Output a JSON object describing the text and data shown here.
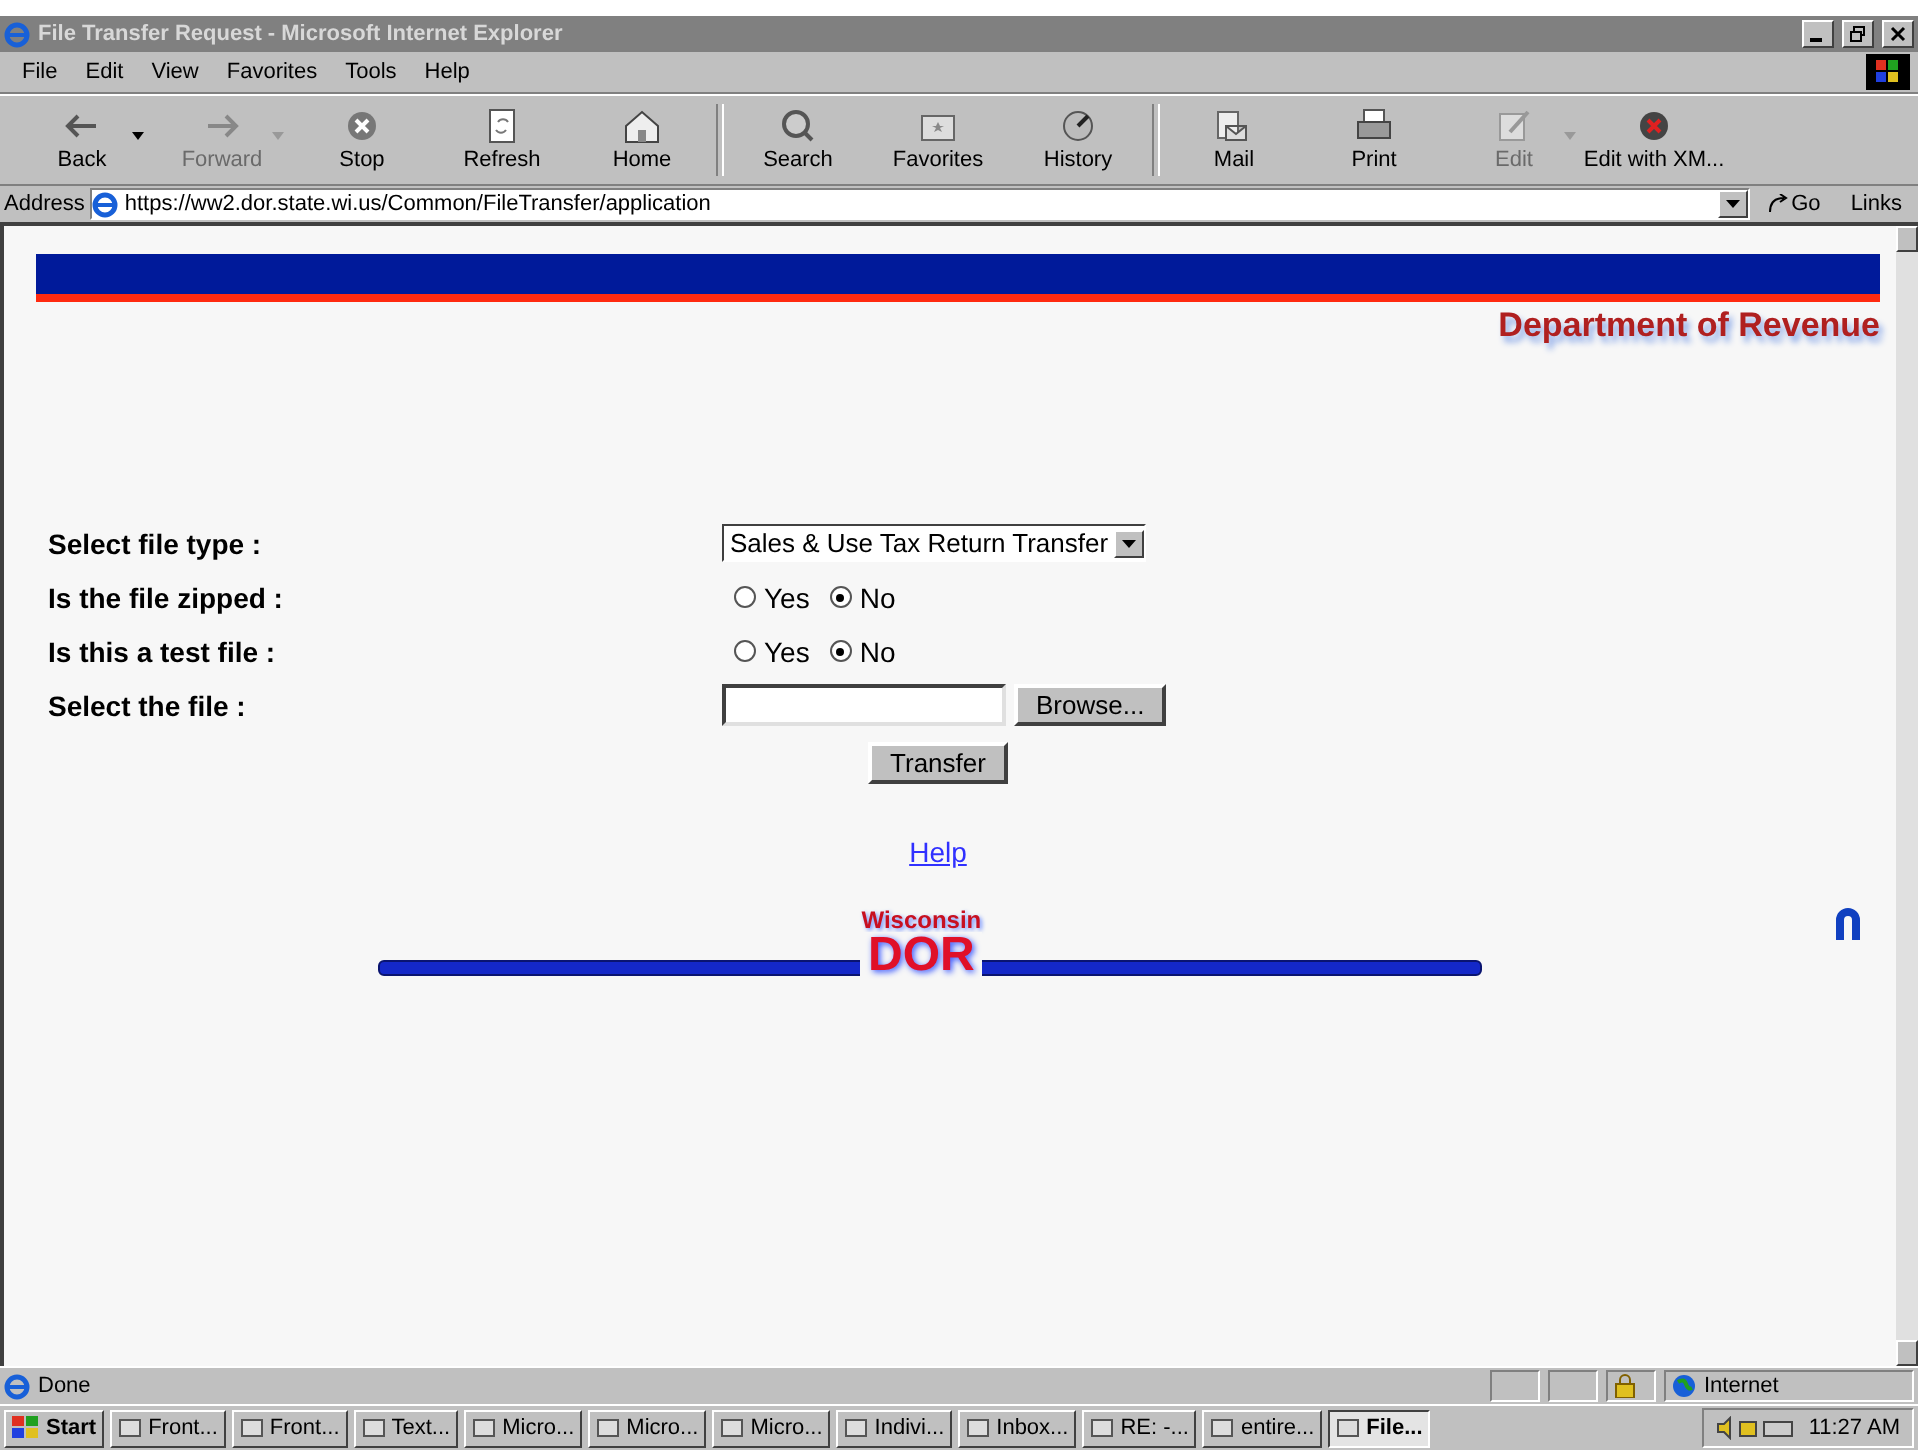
{
  "window": {
    "title": "File Transfer Request - Microsoft Internet Explorer"
  },
  "menu": [
    "File",
    "Edit",
    "View",
    "Favorites",
    "Tools",
    "Help"
  ],
  "toolbar": [
    {
      "kind": "back",
      "label": "Back",
      "disabled": false,
      "dropdown": true
    },
    {
      "kind": "forward",
      "label": "Forward",
      "disabled": true,
      "dropdown": true
    },
    {
      "kind": "stop",
      "label": "Stop",
      "disabled": false,
      "dropdown": false
    },
    {
      "kind": "refresh",
      "label": "Refresh",
      "disabled": false,
      "dropdown": false
    },
    {
      "kind": "home",
      "label": "Home",
      "disabled": false,
      "dropdown": false
    },
    {
      "kind": "search",
      "label": "Search",
      "disabled": false,
      "dropdown": false
    },
    {
      "kind": "favorites",
      "label": "Favorites",
      "disabled": false,
      "dropdown": false
    },
    {
      "kind": "history",
      "label": "History",
      "disabled": false,
      "dropdown": false
    },
    {
      "kind": "mail",
      "label": "Mail",
      "disabled": false,
      "dropdown": false
    },
    {
      "kind": "print",
      "label": "Print",
      "disabled": false,
      "dropdown": false
    },
    {
      "kind": "edit",
      "label": "Edit",
      "disabled": true,
      "dropdown": true
    },
    {
      "kind": "xm",
      "label": "Edit with XM...",
      "disabled": false,
      "dropdown": false
    }
  ],
  "address": {
    "label": "Address",
    "value": "https://ww2.dor.state.wi.us/Common/FileTransfer/application",
    "go": "Go",
    "links": "Links"
  },
  "page": {
    "header": "Department of Revenue",
    "rows": [
      {
        "kind": "select",
        "label": "Select file type :",
        "value": "Sales & Use Tax Return Transfer"
      },
      {
        "kind": "radio",
        "label": "Is the file zipped :",
        "options": [
          {
            "label": "Yes",
            "selected": false
          },
          {
            "label": "No",
            "selected": true
          }
        ]
      },
      {
        "kind": "radio",
        "label": "Is this a test file :",
        "options": [
          {
            "label": "Yes",
            "selected": false
          },
          {
            "label": "No",
            "selected": true
          }
        ]
      },
      {
        "kind": "file",
        "label": "Select the file :",
        "button": "Browse..."
      }
    ],
    "submit": "Transfer",
    "help": "Help",
    "logo_top": "Wisconsin",
    "logo_main": "DOR"
  },
  "status_bar": {
    "text": "Done",
    "zone": "Internet"
  },
  "taskbar": {
    "start": "Start",
    "items": [
      {
        "label": "Front...",
        "selected": false
      },
      {
        "label": "Front...",
        "selected": false
      },
      {
        "label": "Text...",
        "selected": false
      },
      {
        "label": "Micro...",
        "selected": false
      },
      {
        "label": "Micro...",
        "selected": false
      },
      {
        "label": "Micro...",
        "selected": false
      },
      {
        "label": "Indivi...",
        "selected": false
      },
      {
        "label": "Inbox...",
        "selected": false
      },
      {
        "label": "RE:  -...",
        "selected": false
      },
      {
        "label": "entire...",
        "selected": false
      },
      {
        "label": "File...",
        "selected": true
      }
    ],
    "clock": "11:27 AM"
  }
}
